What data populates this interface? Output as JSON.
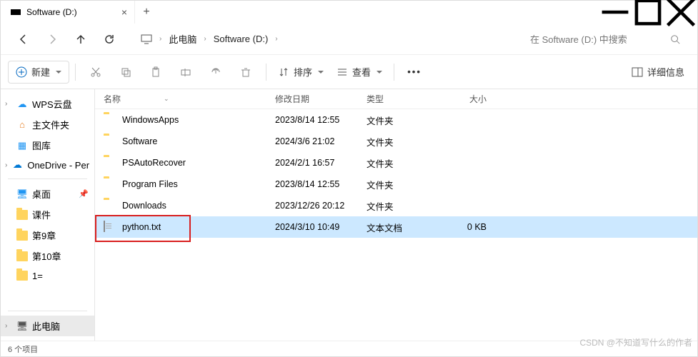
{
  "tab": {
    "title": "Software (D:)"
  },
  "breadcrumb": {
    "root": "此电脑",
    "drive": "Software (D:)"
  },
  "search": {
    "placeholder": "在 Software (D:) 中搜索"
  },
  "toolbar": {
    "new": "新建",
    "sort": "排序",
    "view": "查看",
    "details": "详细信息"
  },
  "sidebar": {
    "wps": "WPS云盘",
    "home": "主文件夹",
    "gallery": "图库",
    "onedrive": "OneDrive - Per",
    "desktop": "桌面",
    "f1": "课件",
    "f2": "第9章",
    "f3": "第10章",
    "f4": "1=",
    "pc": "此电脑"
  },
  "columns": {
    "name": "名称",
    "date": "修改日期",
    "type": "类型",
    "size": "大小"
  },
  "rows": [
    {
      "name": "WindowsApps",
      "date": "2023/8/14 12:55",
      "type": "文件夹",
      "size": "",
      "kind": "folder"
    },
    {
      "name": "Software",
      "date": "2024/3/6 21:02",
      "type": "文件夹",
      "size": "",
      "kind": "folder"
    },
    {
      "name": "PSAutoRecover",
      "date": "2024/2/1 16:57",
      "type": "文件夹",
      "size": "",
      "kind": "folder"
    },
    {
      "name": "Program Files",
      "date": "2023/8/14 12:55",
      "type": "文件夹",
      "size": "",
      "kind": "folder"
    },
    {
      "name": "Downloads",
      "date": "2023/12/26 20:12",
      "type": "文件夹",
      "size": "",
      "kind": "folder"
    },
    {
      "name": "python.txt",
      "date": "2024/3/10 10:49",
      "type": "文本文档",
      "size": "0 KB",
      "kind": "file"
    }
  ],
  "status": "6 个项目",
  "watermark": "CSDN @不知道写什么的作者"
}
